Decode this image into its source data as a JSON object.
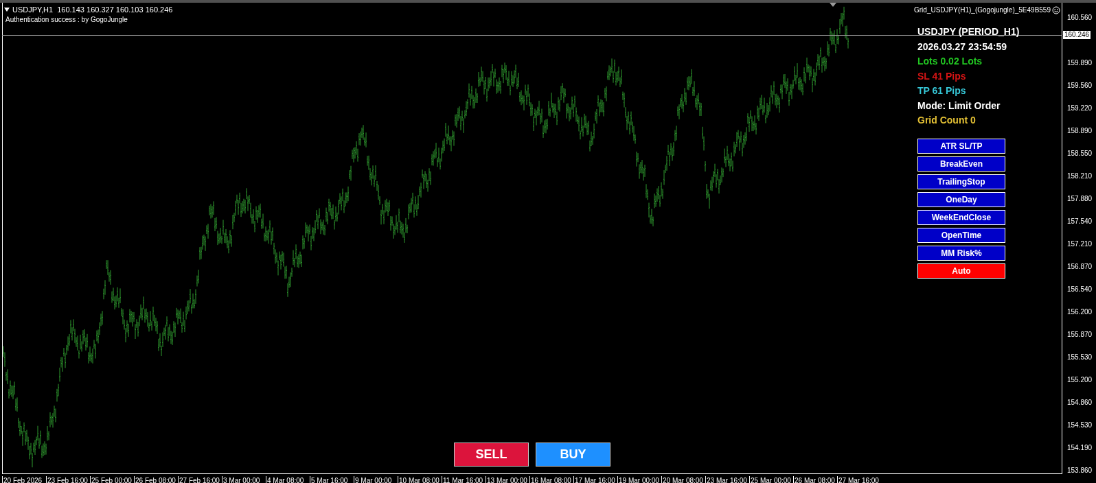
{
  "header": {
    "symbol_line": "USDJPY,H1  160.143 160.327 160.103 160.246",
    "status": "Authentication success : by GogoJungle",
    "expert_name": "Grid_USDJPY(H1)_(Gogojungle)_5E49B559"
  },
  "info_panel": [
    {
      "text": "USDJPY (PERIOD_H1)",
      "color": "#ffffff"
    },
    {
      "text": "2026.03.27 23:54:59",
      "color": "#ffffff"
    },
    {
      "text": "Lots 0.02 Lots",
      "color": "#22c722"
    },
    {
      "text": "SL 41 Pips",
      "color": "#d41414"
    },
    {
      "text": "TP 61 Pips",
      "color": "#36c8d8"
    },
    {
      "text": "Mode: Limit Order",
      "color": "#ffffff"
    },
    {
      "text": "Grid Count 0",
      "color": "#e3c034"
    }
  ],
  "panel_buttons": [
    {
      "label": "ATR SL/TP",
      "color": "#0000c8"
    },
    {
      "label": "BreakEven",
      "color": "#0000c8"
    },
    {
      "label": "TrailingStop",
      "color": "#0000c8"
    },
    {
      "label": "OneDay",
      "color": "#0000c8"
    },
    {
      "label": "WeekEndClose",
      "color": "#0000c8"
    },
    {
      "label": "OpenTime",
      "color": "#0000c8"
    },
    {
      "label": "MM Risk%",
      "color": "#0000c8"
    },
    {
      "label": "Auto",
      "color": "#ff0000"
    }
  ],
  "trade_buttons": [
    {
      "label": "SELL",
      "color": "#dc143c"
    },
    {
      "label": "BUY",
      "color": "#1e90ff"
    }
  ],
  "price_axis": [
    "160.560",
    "159.890",
    "159.560",
    "159.220",
    "158.890",
    "158.550",
    "158.210",
    "157.880",
    "157.540",
    "157.210",
    "156.870",
    "156.540",
    "156.200",
    "155.870",
    "155.530",
    "155.200",
    "154.860",
    "154.530",
    "154.190",
    "153.860"
  ],
  "current_price": "160.246",
  "time_axis": [
    "20 Feb 2026",
    "23 Feb 16:00",
    "25 Feb 00:00",
    "26 Feb 08:00",
    "27 Feb 16:00",
    "3 Mar 00:00",
    "4 Mar 08:00",
    "5 Mar 16:00",
    "9 Mar 00:00",
    "10 Mar 08:00",
    "11 Mar 16:00",
    "13 Mar 00:00",
    "16 Mar 08:00",
    "17 Mar 16:00",
    "19 Mar 00:00",
    "20 Mar 08:00",
    "23 Mar 16:00",
    "25 Mar 00:00",
    "26 Mar 08:00",
    "27 Mar 16:00"
  ]
}
